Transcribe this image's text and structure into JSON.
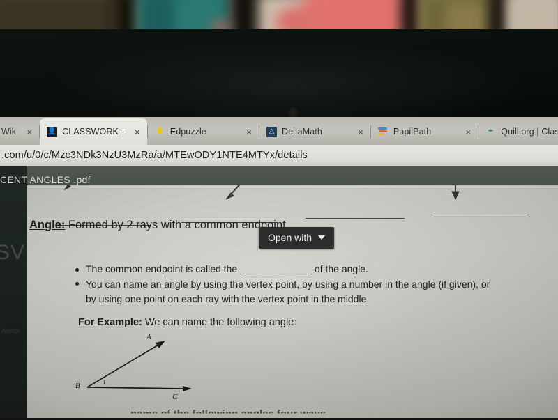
{
  "scene": {
    "description": "photo-of-laptop-screen",
    "bezel_color": "#0a0f0c",
    "background_colors": [
      "#cdbfae",
      "#1d5f5c",
      "#e2726d",
      "#6e6638"
    ]
  },
  "browser": {
    "tabs": [
      {
        "title": "Wik",
        "favicon": "wikipedia-icon",
        "active": false,
        "closable": true
      },
      {
        "title": "CLASSWORK -",
        "favicon": "google-classroom-icon",
        "active": true,
        "closable": true
      },
      {
        "title": "Edpuzzle",
        "favicon": "edpuzzle-icon",
        "active": false,
        "closable": true
      },
      {
        "title": "DeltaMath",
        "favicon": "deltamath-icon",
        "active": false,
        "closable": true
      },
      {
        "title": "PupilPath",
        "favicon": "pupilpath-icon",
        "active": false,
        "closable": true
      },
      {
        "title": "Quill.org | Clas",
        "favicon": "quill-icon",
        "active": false,
        "closable": true
      }
    ],
    "pinned_icon": "yahoo-icon",
    "close_glyph": "×",
    "url": ".com/u/0/c/Mzc3NDk3NzU3MzRa/a/MTEwODY1NTE4MTYx/details"
  },
  "classroom": {
    "rail_ghost_text": "SV",
    "rail_ghost_text_2": "Assign"
  },
  "pdf_viewer": {
    "file_name": "CENT ANGLES .pdf",
    "open_with_label": "Open with",
    "open_with_caret": "caret-down-icon"
  },
  "document": {
    "heading_bold": "Angle:",
    "heading_rest": " Formed by 2 rays with a common endpoint.",
    "bullets": [
      {
        "before_blank": "The common endpoint is called the",
        "after_blank": "of the angle.",
        "has_blank": true
      },
      {
        "line_1": "You can name an angle by using the vertex point, by using a number in the angle (if given), or",
        "line_2": "by using one point on each ray with the vertex point in the middle.",
        "has_blank": false
      }
    ],
    "example_bold": "For Example:",
    "example_rest": "  We can name the following angle:",
    "figure": {
      "vertex_label": "B",
      "ray_a_label": "A",
      "ray_c_label": "C",
      "angle_number": "1"
    },
    "bottom_cut_text": "name of the following angles four ways",
    "blank_lines_count": 4
  }
}
